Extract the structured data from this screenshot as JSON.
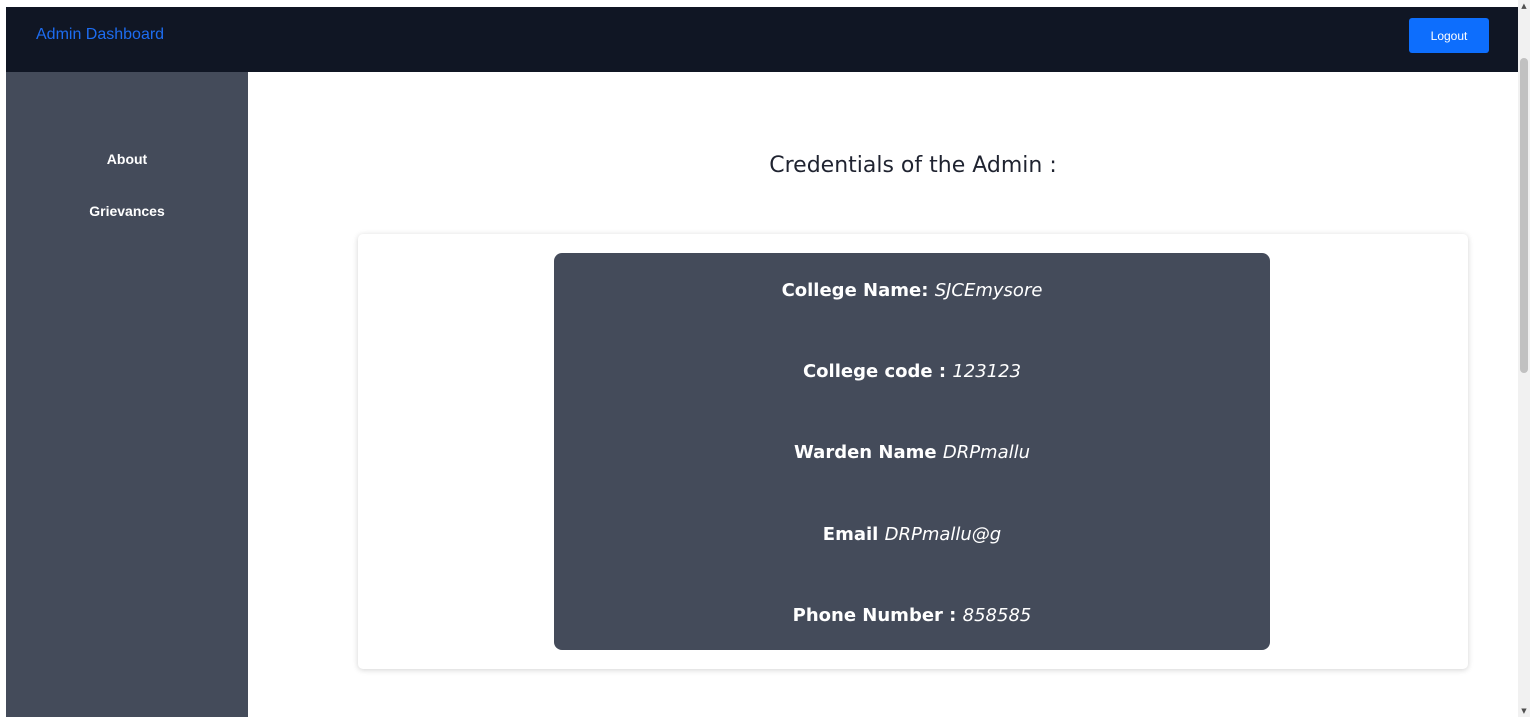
{
  "header": {
    "brand": "Admin Dashboard",
    "logout_label": "Logout"
  },
  "sidebar": {
    "items": [
      {
        "label": "About"
      },
      {
        "label": "Grievances"
      }
    ]
  },
  "main": {
    "title": "Credentials of the Admin :",
    "credentials": [
      {
        "label": "College Name:",
        "value": "SJCEmysore"
      },
      {
        "label": "College code :",
        "value": "123123"
      },
      {
        "label": "Warden Name",
        "value": "DRPmallu"
      },
      {
        "label": "Email",
        "value": "DRPmallu@g"
      },
      {
        "label": "Phone Number :",
        "value": "858585"
      }
    ]
  },
  "scrollbar": {
    "up_icon": "▲",
    "down_icon": "▼"
  },
  "colors": {
    "header_bg": "#101624",
    "brand": "#1d6cf0",
    "logout_bg": "#0d6efd",
    "sidebar_bg": "#444b5a",
    "panel_bg": "#444b5a"
  }
}
